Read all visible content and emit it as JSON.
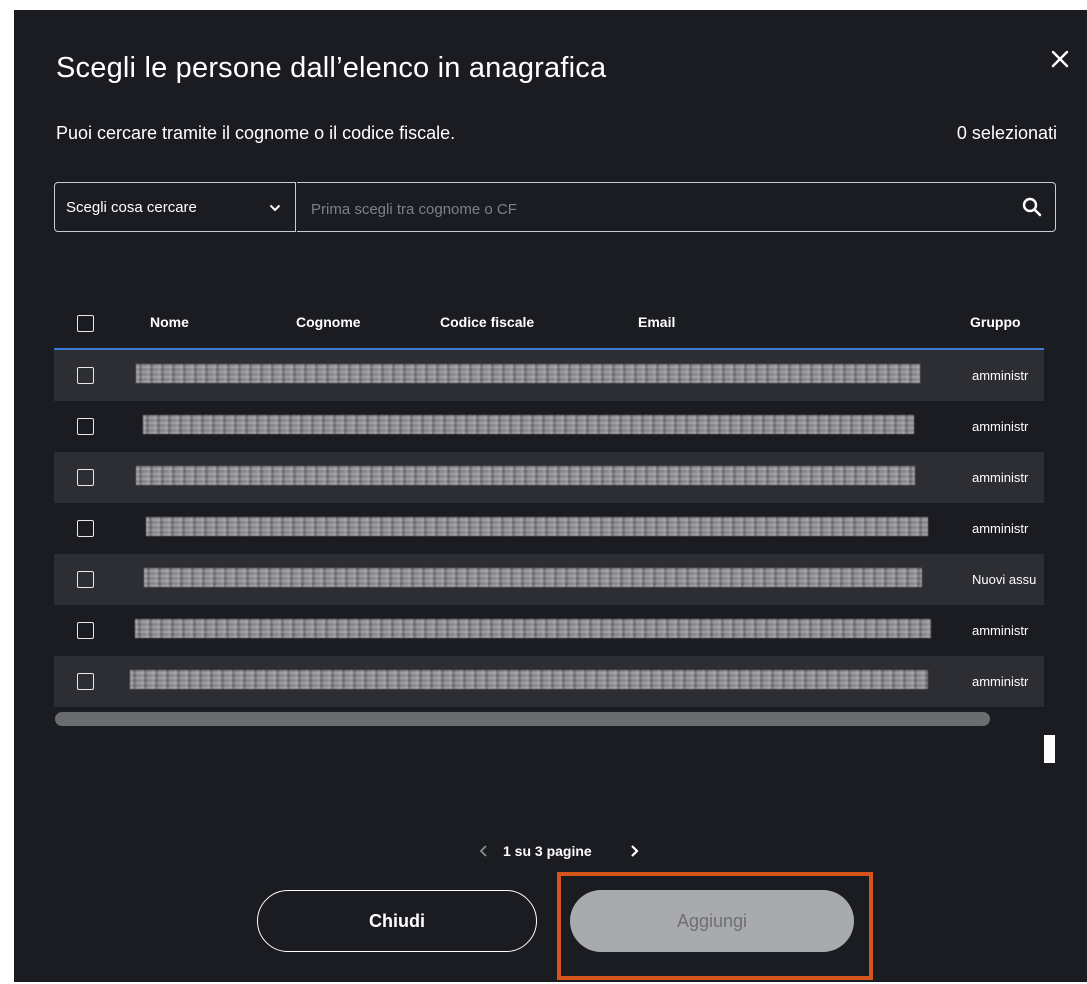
{
  "dialog": {
    "title": "Scegli le persone dall’elenco in anagrafica",
    "subtitle": "Puoi cercare tramite il cognome o il codice fiscale.",
    "selected_count": "0 selezionati"
  },
  "search": {
    "select_label": "Scegli cosa cercare",
    "placeholder": "Prima scegli tra cognome o CF",
    "value": ""
  },
  "table": {
    "columns": [
      "Nome",
      "Cognome",
      "Codice fiscale",
      "Email",
      "Gruppo"
    ],
    "rows": [
      {
        "gruppo": "amministr"
      },
      {
        "gruppo": "amministr"
      },
      {
        "gruppo": "amministr"
      },
      {
        "gruppo": "amministr"
      },
      {
        "gruppo": "Nuovi assu"
      },
      {
        "gruppo": "amministr"
      },
      {
        "gruppo": "amministr"
      }
    ]
  },
  "pagination": {
    "text": "1 su 3 pagine"
  },
  "footer": {
    "close_label": "Chiudi",
    "add_label": "Aggiungi"
  },
  "colors": {
    "modal_bg": "#1b1c21",
    "row_alt_bg": "#2d2e33",
    "header_underline": "#3a7bd5",
    "highlight_border": "#d4561a",
    "add_button_disabled": "#a9aaae"
  }
}
